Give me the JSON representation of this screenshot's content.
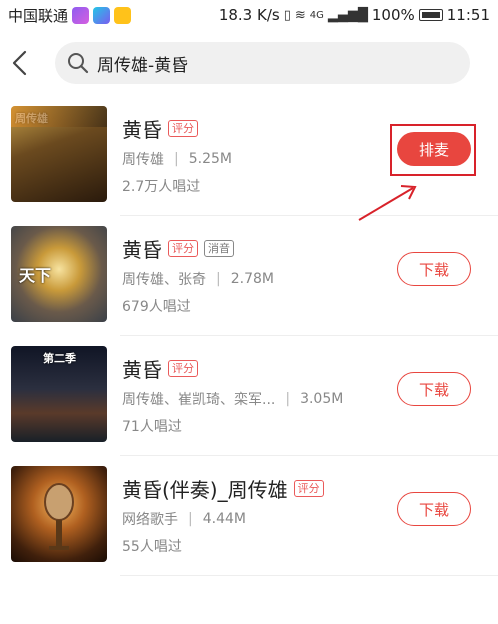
{
  "status_bar": {
    "carrier": "中国联通",
    "network_speed": "18.3 K/s",
    "signal_type": "4G",
    "battery": "100%",
    "time": "11:51"
  },
  "search": {
    "query": "周传雄-黄昏"
  },
  "songs": [
    {
      "title": "黄昏",
      "tags": [
        "评分"
      ],
      "artist": "周传雄",
      "size": "5.25M",
      "plays": "2.7万人唱过",
      "action": "排麦",
      "cover_text": "周传雄"
    },
    {
      "title": "黄昏",
      "tags": [
        "评分",
        "消音"
      ],
      "artist": "周传雄、张奇",
      "size": "2.78M",
      "plays": "679人唱过",
      "action": "下载",
      "cover_text": "天下"
    },
    {
      "title": "黄昏",
      "tags": [
        "评分"
      ],
      "artist": "周传雄、崔凯琦、栾军...",
      "size": "3.05M",
      "plays": "71人唱过",
      "action": "下载",
      "cover_text": "第二季"
    },
    {
      "title": "黄昏(伴奏)_周传雄",
      "tags": [
        "评分"
      ],
      "artist": "网络歌手",
      "size": "4.44M",
      "plays": "55人唱过",
      "action": "下载",
      "cover_text": ""
    }
  ],
  "colors": {
    "accent": "#e8463f",
    "annotation": "#d8222a"
  }
}
